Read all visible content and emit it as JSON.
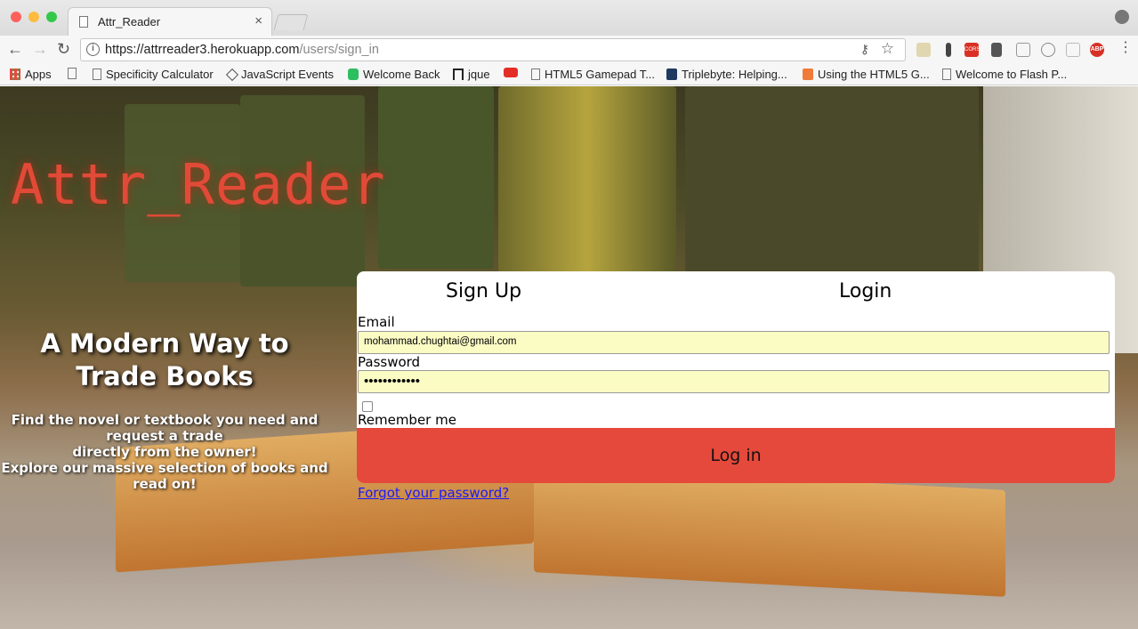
{
  "browser": {
    "tab_title": "Attr_Reader",
    "tab_close": "×",
    "url_host": "https://attrreader3.herokuapp.com",
    "url_path": "/users/sign_in",
    "info_icon": "i",
    "key_icon": "⚷",
    "star_icon": "☆",
    "back_icon": "←",
    "forward_icon": "→",
    "reload_icon": "↻",
    "extensions": [
      "CORS",
      "ABP"
    ]
  },
  "bookmarks": [
    {
      "label": "Apps",
      "icon": "apps-grid-icon"
    },
    {
      "label": "",
      "icon": "page-icon"
    },
    {
      "label": "Specificity Calculator",
      "icon": "page-icon"
    },
    {
      "label": "JavaScript Events",
      "icon": "diamond-icon"
    },
    {
      "label": "Welcome Back",
      "icon": "evernote-icon"
    },
    {
      "label": "jque",
      "icon": "jquery-icon"
    },
    {
      "label": "",
      "icon": "youtube-icon"
    },
    {
      "label": "HTML5 Gamepad T...",
      "icon": "page-icon"
    },
    {
      "label": "Triplebyte: Helping...",
      "icon": "triplebyte-icon"
    },
    {
      "label": "Using the HTML5 G...",
      "icon": "plus-icon"
    },
    {
      "label": "Welcome to Flash P...",
      "icon": "page-icon"
    }
  ],
  "hero": {
    "logo": "Attr_Reader",
    "headline": "A Modern Way to Trade Books",
    "subtext_line1": "Find the novel or textbook you need and request a trade",
    "subtext_line2": "directly from the owner!",
    "subtext_line3": "Explore our massive selection of books and read on!"
  },
  "form": {
    "tab_signup": "Sign Up",
    "tab_login": "Login",
    "email_label": "Email",
    "email_value": "mohammad.chughtai@gmail.com",
    "password_label": "Password",
    "password_value": "••••••••••••",
    "remember_label": "Remember me",
    "remember_checked": false,
    "submit_label": "Log in",
    "forgot_link": "Forgot your password?"
  },
  "colors": {
    "accent": "#e5493b",
    "logo": "#e24a38",
    "autofill": "#fbfbc4",
    "link": "#1a1aff"
  }
}
